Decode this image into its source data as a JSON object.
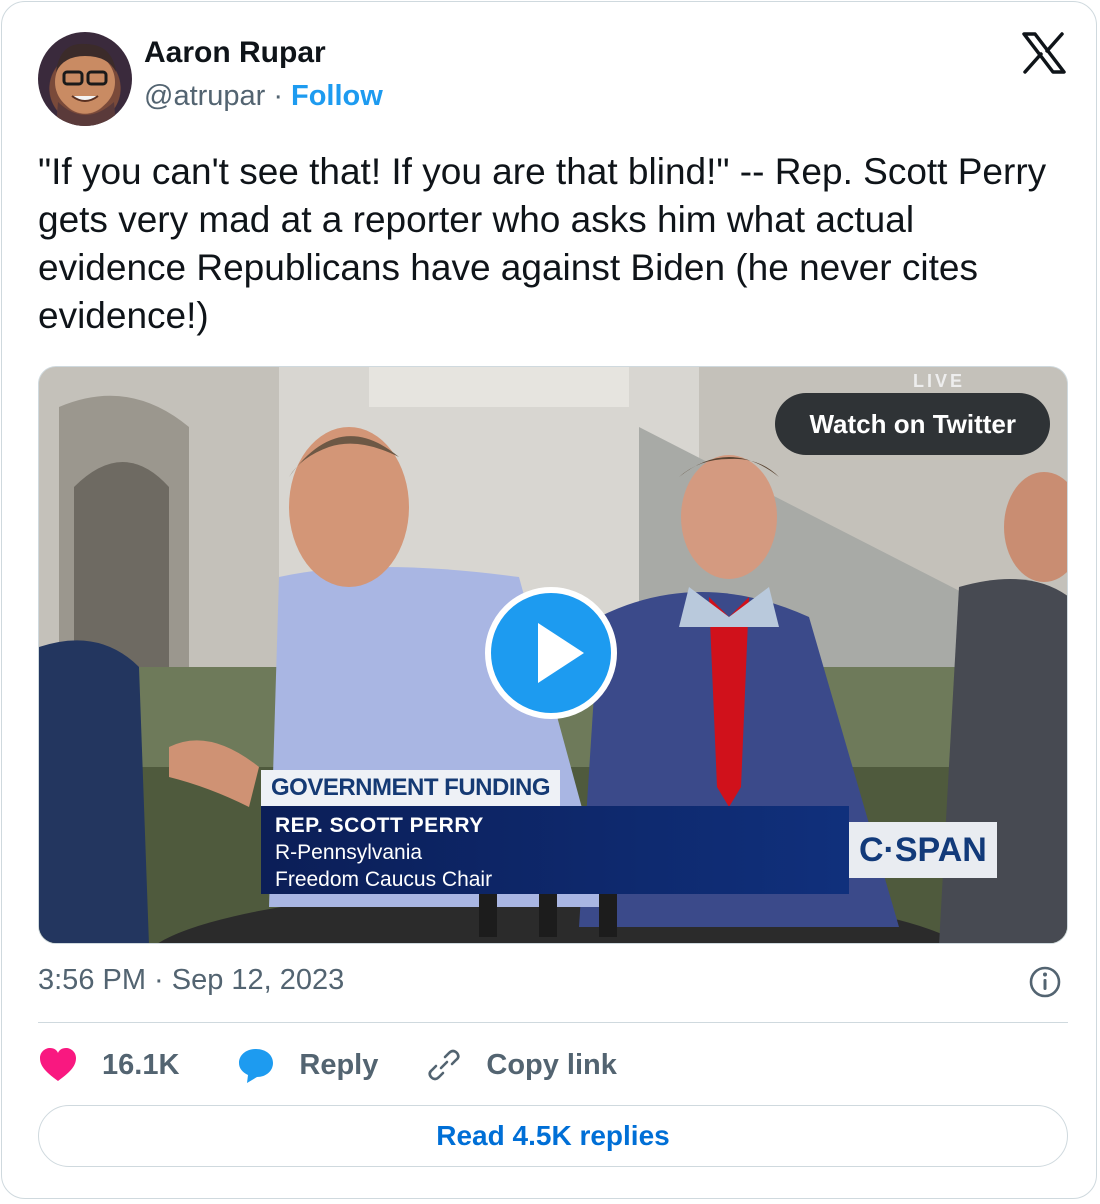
{
  "author": {
    "name": "Aaron Rupar",
    "handle": "@atrupar",
    "separator": "·",
    "follow_label": "Follow"
  },
  "tweet": {
    "text": "\"If you can't see that! If you are that blind!\" -- Rep. Scott Perry gets very mad at a reporter who asks him what actual evidence Republicans have against Biden (he never cites evidence!)",
    "timestamp": "3:56 PM · Sep 12, 2023"
  },
  "media": {
    "watch_label": "Watch on Twitter",
    "live_label": "LIVE",
    "chyron_headline": "GOVERNMENT FUNDING",
    "chyron_name": "REP. SCOTT PERRY",
    "chyron_party": "R-Pennsylvania",
    "chyron_title": "Freedom Caucus Chair",
    "network_logo": "C·SPAN"
  },
  "actions": {
    "like_count": "16.1K",
    "reply_label": "Reply",
    "copy_label": "Copy link"
  },
  "footer": {
    "read_replies_label": "Read 4.5K replies"
  },
  "colors": {
    "accent": "#1d9bf0",
    "like": "#f91880",
    "link": "#006fd6",
    "secondary_text": "#536471"
  },
  "icons": [
    "x-logo-icon",
    "play-icon",
    "info-icon",
    "heart-icon",
    "reply-bubble-icon",
    "link-icon"
  ]
}
